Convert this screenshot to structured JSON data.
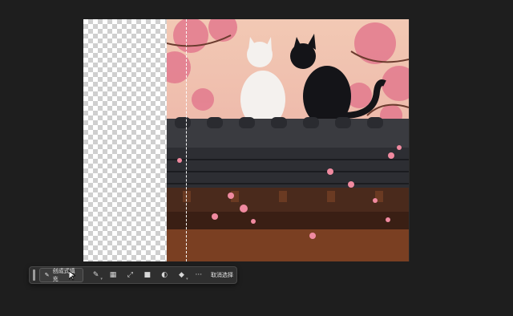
{
  "contextual_taskbar": {
    "generative_fill_label": "创成式填充",
    "deselect_label": "取消选择",
    "tools": [
      {
        "name": "brush-icon",
        "glyph": "✎"
      },
      {
        "name": "mask-icon",
        "glyph": "▦"
      },
      {
        "name": "transform-icon",
        "glyph": "⤢"
      },
      {
        "name": "fill-square-icon",
        "glyph": "■"
      },
      {
        "name": "contrast-icon",
        "glyph": "◐"
      },
      {
        "name": "paint-bucket-icon",
        "glyph": "◆"
      },
      {
        "name": "more-icon",
        "glyph": "···"
      }
    ]
  },
  "colors": {
    "workspace": "#1e1e1e",
    "taskbar": "#2f2f2f",
    "sakura": "#e8758f"
  }
}
